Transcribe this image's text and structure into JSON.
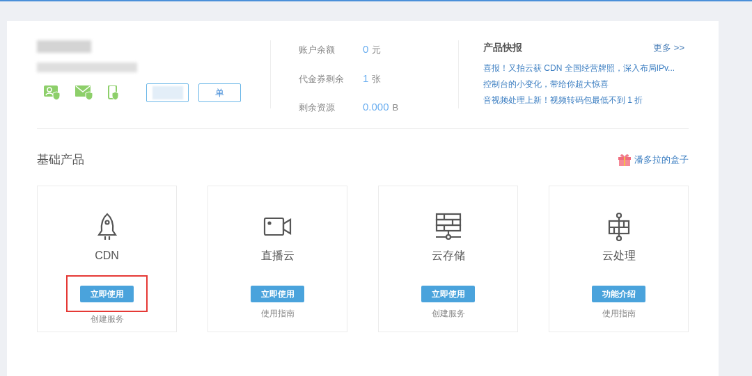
{
  "account": {
    "buttons": [
      {
        "obscured": true
      },
      {
        "label": "单",
        "obscured": false
      }
    ]
  },
  "stats": [
    {
      "label": "账户余额",
      "value": "0",
      "unit": "元"
    },
    {
      "label": "代金券剩余",
      "value": "1",
      "unit": "张"
    },
    {
      "label": "剩余资源",
      "value": "0.000",
      "unit": "B"
    }
  ],
  "news": {
    "title": "产品快报",
    "more": "更多 >>",
    "items": [
      "喜报！又拍云获 CDN 全国经营牌照，深入布局IPv...",
      "控制台的小变化，带给你超大惊喜",
      "音视频处理上新！视频转码包最低不到 1 折"
    ]
  },
  "section": {
    "title": "基础产品",
    "link": "潘多拉的盒子"
  },
  "products": [
    {
      "kind": "rocket",
      "name": "CDN",
      "button": "立即使用",
      "sub": "创建服务",
      "highlighted": true
    },
    {
      "kind": "camera",
      "name": "直播云",
      "button": "立即使用",
      "sub": "使用指南",
      "highlighted": false
    },
    {
      "kind": "storage",
      "name": "云存储",
      "button": "立即使用",
      "sub": "创建服务",
      "highlighted": false
    },
    {
      "kind": "process",
      "name": "云处理",
      "button": "功能介绍",
      "sub": "使用指南",
      "highlighted": false
    }
  ]
}
